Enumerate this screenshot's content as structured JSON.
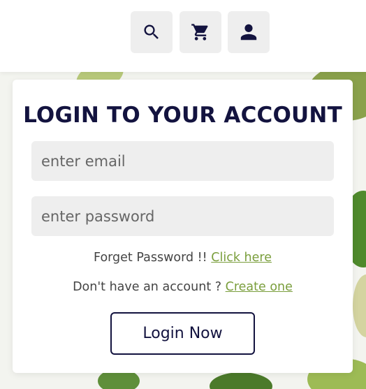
{
  "header": {
    "search_icon": "search-icon",
    "cart_icon": "cart-icon",
    "user_icon": "user-icon"
  },
  "login": {
    "title": "LOGIN TO YOUR ACCOUNT",
    "email_placeholder": "enter email",
    "password_placeholder": "enter password",
    "forget_text": "Forget Password !!",
    "forget_link": "Click here",
    "signup_text": "Don't have an account ?",
    "signup_link": "Create one",
    "button_label": "Login Now"
  },
  "colors": {
    "primary": "#13133f",
    "accent": "#7a9e3c",
    "field_bg": "#eeeeee"
  }
}
